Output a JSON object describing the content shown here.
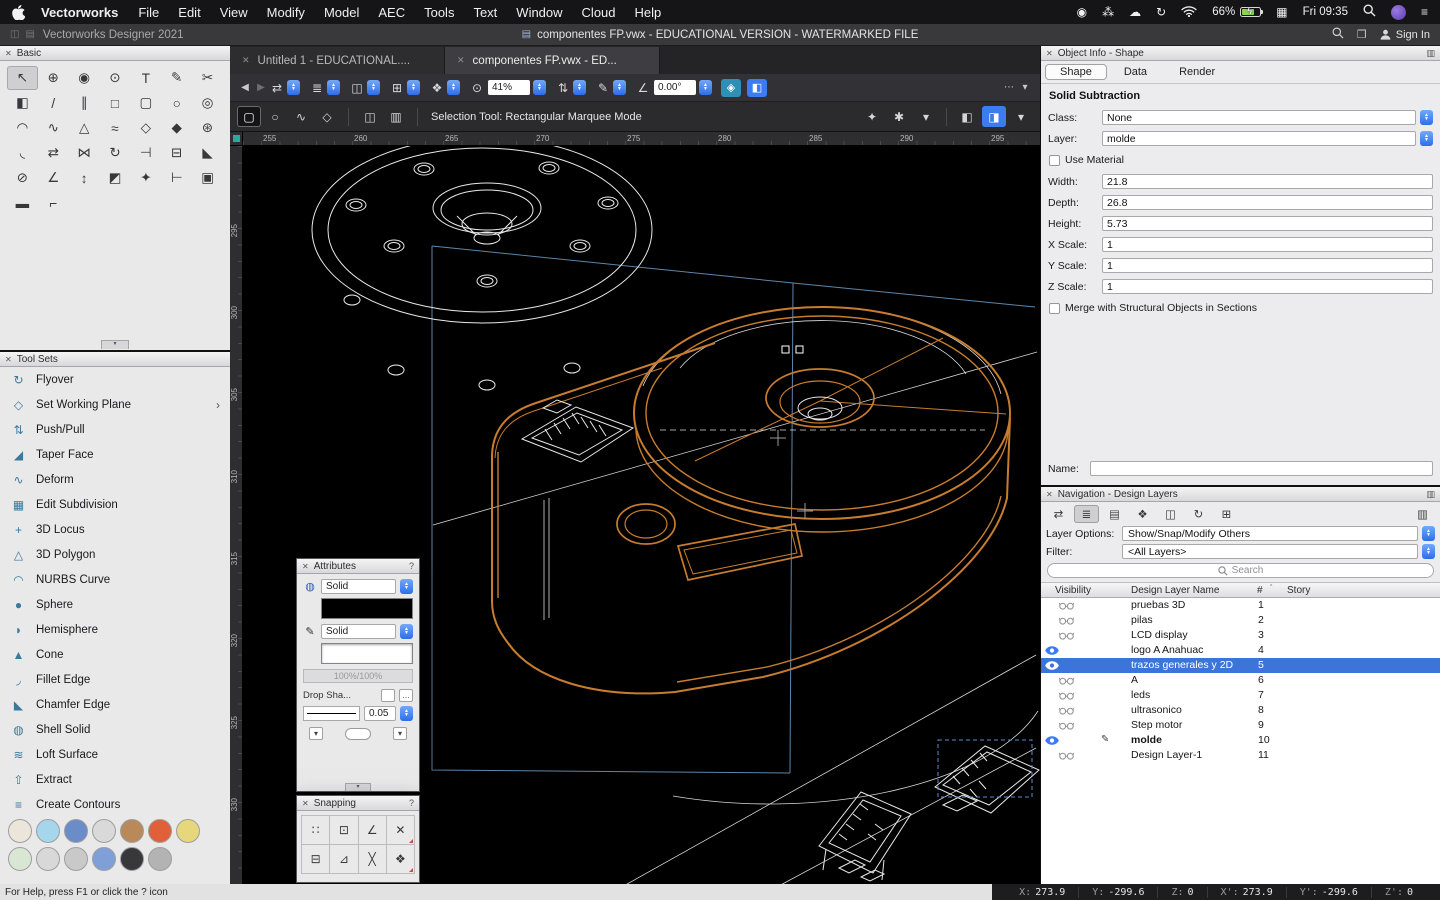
{
  "colors": {
    "accent_blue": "#3b7df0",
    "selection_blue": "#3d74d9",
    "canvas_bg": "#000000",
    "wireframe_white": "#e9e9ea",
    "highlight_orange": "#c87d2e",
    "construction_blue": "#5d86ac"
  },
  "icons": {
    "close": "✕",
    "document": "▤",
    "window_a": "◫",
    "window_b": "▤",
    "book": "❐",
    "help": "?",
    "palette_menu": "▥",
    "collapse": "▾",
    "small_chevron": "▾",
    "dots": "…",
    "chevron_right": "›",
    "sort": "ˆ",
    "display": "▦",
    "menu": "≡"
  },
  "menubar": {
    "app_name": "Vectorworks",
    "menus": [
      "File",
      "Edit",
      "View",
      "Modify",
      "Model",
      "AEC",
      "Tools",
      "Text",
      "Window",
      "Cloud",
      "Help"
    ],
    "status_icons": [
      {
        "name": "camera-icon",
        "glyph": "◉"
      },
      {
        "name": "paw-icon",
        "glyph": "⁂"
      },
      {
        "name": "cloud-icon",
        "glyph": "☁"
      },
      {
        "name": "sync-icon",
        "glyph": "↻"
      }
    ],
    "battery_pct": "66%",
    "clock": "Fri 09:35"
  },
  "titlebar": {
    "app_label": "Vectorworks Designer 2021",
    "doc_title": "componentes FP.vwx - EDUCATIONAL VERSION - WATERMARKED FILE",
    "sign_in_label": "Sign In"
  },
  "tabs": [
    {
      "label": "Untitled 1 - EDUCATIONAL...."
    },
    {
      "label": "componentes FP.vwx - ED..."
    }
  ],
  "toolbar": {
    "back_glyph": "◀",
    "forward_glyph": "▶",
    "groups": [
      {
        "name": "view-sync-control",
        "glyph": "⇄"
      },
      {
        "name": "layer-view-control",
        "glyph": "≣"
      },
      {
        "name": "plane-mode-control",
        "glyph": "◫"
      },
      {
        "name": "grid-control",
        "glyph": "⊞"
      },
      {
        "name": "class-options-control",
        "glyph": "❖"
      }
    ],
    "zoom_icon_glyph": "⊙",
    "zoom_value": "41%",
    "groups2": [
      {
        "name": "fit-view-control",
        "glyph": "⇅"
      },
      {
        "name": "annotation-control",
        "glyph": "✎"
      }
    ],
    "angle_icon_glyph": "∠",
    "angle_value": "0.00°",
    "groups3": [
      {
        "name": "render-mode-button",
        "glyph": "◈",
        "color": "#2f8fb5"
      },
      {
        "name": "view-preset-button",
        "glyph": "◧",
        "color": "#3b7df0"
      }
    ],
    "overflow_glyph": "⋯",
    "chevron_glyph": "▾",
    "mode_buttons": [
      {
        "name": "rectangular-marquee-mode",
        "glyph": "▢",
        "active": true
      },
      {
        "name": "oval-marquee-mode",
        "glyph": "○"
      },
      {
        "name": "lasso-marquee-mode",
        "glyph": "∿"
      },
      {
        "name": "polygon-marquee-mode",
        "glyph": "◇"
      }
    ],
    "mode_buttons2": [
      {
        "name": "interactive-scaling-mode",
        "glyph": "◫"
      },
      {
        "name": "symbol-insertion-mode",
        "glyph": "▥"
      }
    ],
    "mode_label": "Selection Tool: Rectangular Marquee Mode",
    "right_icons": [
      {
        "name": "magic-wand-button",
        "glyph": "✦"
      },
      {
        "name": "tool-preferences-gear",
        "glyph": "✱"
      },
      {
        "name": "gear-chevron",
        "glyph": "▾"
      },
      {
        "name": "separator"
      },
      {
        "name": "push-pull-cube-button",
        "glyph": "◧"
      },
      {
        "name": "auto-plane-cube-button",
        "glyph": "◨",
        "active": true
      },
      {
        "name": "cube-chevron",
        "glyph": "▾"
      }
    ]
  },
  "basic_palette": {
    "title": "Basic",
    "tools": [
      {
        "name": "tool-selection",
        "glyph": "↖"
      },
      {
        "name": "tool-pan",
        "glyph": "⊕"
      },
      {
        "name": "tool-flyover",
        "glyph": "◉"
      },
      {
        "name": "tool-zoom",
        "glyph": "⊙"
      },
      {
        "name": "tool-text",
        "glyph": "T"
      },
      {
        "name": "tool-callout",
        "glyph": "✎"
      },
      {
        "name": "tool-split",
        "glyph": "✂"
      },
      {
        "name": "tool-visibility",
        "glyph": "◧"
      },
      {
        "name": "tool-line",
        "glyph": "/"
      },
      {
        "name": "tool-double-line",
        "glyph": "∥"
      },
      {
        "name": "tool-rectangle",
        "glyph": "□"
      },
      {
        "name": "tool-rounded-rectangle",
        "glyph": "▢"
      },
      {
        "name": "tool-oval",
        "glyph": "○"
      },
      {
        "name": "tool-circle",
        "glyph": "◎"
      },
      {
        "name": "tool-arc",
        "glyph": "◠"
      },
      {
        "name": "tool-freehand",
        "glyph": "∿"
      },
      {
        "name": "tool-triangle",
        "glyph": "△"
      },
      {
        "name": "tool-polyline",
        "glyph": "≈"
      },
      {
        "name": "tool-polygon",
        "glyph": "◇"
      },
      {
        "name": "tool-regular-polygon",
        "glyph": "◆"
      },
      {
        "name": "tool-spiral",
        "glyph": "⊛"
      },
      {
        "name": "tool-fillet",
        "glyph": "◟"
      },
      {
        "name": "tool-offset",
        "glyph": "⇄"
      },
      {
        "name": "tool-mirror",
        "glyph": "⋈"
      },
      {
        "name": "tool-rotate",
        "glyph": "↻"
      },
      {
        "name": "tool-trim",
        "glyph": "⊣"
      },
      {
        "name": "tool-clip",
        "glyph": "⊟"
      },
      {
        "name": "tool-chamfer",
        "glyph": "◣"
      },
      {
        "name": "tool-drill",
        "glyph": "⊘"
      },
      {
        "name": "tool-protractor",
        "glyph": "∠"
      },
      {
        "name": "tool-move-by-points",
        "glyph": "↕"
      },
      {
        "name": "tool-attribute-mapping",
        "glyph": "◩"
      },
      {
        "name": "tool-eyedropper",
        "glyph": "✦"
      },
      {
        "name": "tool-tape-measure",
        "glyph": "⊢"
      },
      {
        "name": "tool-stamp",
        "glyph": "▣"
      },
      {
        "name": "tool-reshape",
        "glyph": "▬"
      },
      {
        "name": "tool-locus",
        "glyph": "⌐"
      }
    ]
  },
  "tool_sets": {
    "title": "Tool Sets",
    "items": [
      {
        "label": "Flyover",
        "glyph": "↻"
      },
      {
        "label": "Set Working Plane",
        "glyph": "◇",
        "chevron": true
      },
      {
        "label": "Push/Pull",
        "glyph": "⇅"
      },
      {
        "label": "Taper Face",
        "glyph": "◢"
      },
      {
        "label": "Deform",
        "glyph": "∿"
      },
      {
        "label": "Edit Subdivision",
        "glyph": "▦"
      },
      {
        "label": "3D Locus",
        "glyph": "+"
      },
      {
        "label": "3D Polygon",
        "glyph": "△"
      },
      {
        "label": "NURBS Curve",
        "glyph": "◠"
      },
      {
        "label": "Sphere",
        "glyph": "●"
      },
      {
        "label": "Hemisphere",
        "glyph": "◗"
      },
      {
        "label": "Cone",
        "glyph": "▲"
      },
      {
        "label": "Fillet Edge",
        "glyph": "◞"
      },
      {
        "label": "Chamfer Edge",
        "glyph": "◣"
      },
      {
        "label": "Shell Solid",
        "glyph": "◍"
      },
      {
        "label": "Loft Surface",
        "glyph": "≋"
      },
      {
        "label": "Extract",
        "glyph": "⇧"
      },
      {
        "label": "Create Contours",
        "glyph": "≡"
      }
    ],
    "footer_rows": [
      [
        {
          "name": "toolset-icon-teardrop",
          "color": "#ece5da"
        },
        {
          "name": "toolset-icon-droplet",
          "color": "#a6d6ec"
        },
        {
          "name": "toolset-icon-sphere",
          "color": "#6a8cc8"
        },
        {
          "name": "toolset-icon-ring",
          "color": "#d9d9d9"
        },
        {
          "name": "toolset-icon-pot",
          "color": "#b9895a"
        },
        {
          "name": "toolset-icon-flame",
          "color": "#e0603a"
        },
        {
          "name": "toolset-icon-clay",
          "color": "#e6d67c"
        }
      ],
      [
        {
          "name": "toolset-icon-plant",
          "color": "#d9e6d4"
        },
        {
          "name": "toolset-icon-pen",
          "color": "#d8d8d8"
        },
        {
          "name": "toolset-icon-cup",
          "color": "#c9c9c9"
        },
        {
          "name": "toolset-icon-blue",
          "color": "#7f9fd8"
        },
        {
          "name": "toolset-icon-dark-sphere",
          "color": "#38383a"
        },
        {
          "name": "toolset-icon-gear",
          "color": "#b3b3b3"
        }
      ]
    ]
  },
  "attributes": {
    "title": "Attributes",
    "fill_bucket_glyph": "◍",
    "pen_glyph": "✎",
    "fill_style": "Solid",
    "pen_style": "Solid",
    "opacity_label": "100%/100%",
    "drop_shadow_label": "Drop Sha...",
    "line_weight": "0.05"
  },
  "snapping": {
    "title": "Snapping",
    "buttons": [
      {
        "name": "snap-to-grid",
        "glyph": "∷"
      },
      {
        "name": "snap-to-object",
        "glyph": "⊡"
      },
      {
        "name": "snap-to-angle",
        "glyph": "∠"
      },
      {
        "name": "smart-points",
        "glyph": "✕"
      },
      {
        "name": "snap-to-distance",
        "glyph": "⊟"
      },
      {
        "name": "smart-edge",
        "glyph": "⊿"
      },
      {
        "name": "snap-to-intersection",
        "glyph": "╳"
      },
      {
        "name": "snap-loci",
        "glyph": "❖"
      }
    ]
  },
  "object_info": {
    "title": "Object Info - Shape",
    "tabs": [
      "Shape",
      "Data",
      "Render"
    ],
    "object_type": "Solid Subtraction",
    "class_label": "Class:",
    "class_value": "None",
    "layer_label": "Layer:",
    "layer_value": "molde",
    "use_material_label": "Use Material",
    "width_label": "Width:",
    "width_value": "21.8",
    "depth_label": "Depth:",
    "depth_value": "26.8",
    "height_label": "Height:",
    "height_value": "5.73",
    "xscale_label": "X Scale:",
    "xscale_value": "1",
    "yscale_label": "Y Scale:",
    "yscale_value": "1",
    "zscale_label": "Z Scale:",
    "zscale_value": "1",
    "merge_label": "Merge with Structural Objects in Sections",
    "name_label": "Name:",
    "name_value": ""
  },
  "navigation": {
    "title": "Navigation - Design Layers",
    "view_icons": [
      {
        "name": "edit-reference-icon",
        "glyph": "⇄"
      },
      {
        "name": "design-layers-icon",
        "glyph": "≣",
        "active": true
      },
      {
        "name": "sheet-layers-icon",
        "glyph": "▤"
      },
      {
        "name": "classes-icon",
        "glyph": "❖"
      },
      {
        "name": "viewports-icon",
        "glyph": "◫"
      },
      {
        "name": "saved-views-icon",
        "glyph": "↻"
      },
      {
        "name": "references-icon",
        "glyph": "⊞"
      },
      {
        "name": "palette-options-icon",
        "glyph": "▥",
        "right": true
      }
    ],
    "layer_options_label": "Layer Options:",
    "layer_options_value": "Show/Snap/Modify Others",
    "filter_label": "Filter:",
    "filter_value": "<All Layers>",
    "search_placeholder": "Search",
    "columns": [
      "Visibility",
      "Design Layer Name",
      "#",
      "Story"
    ],
    "layers": [
      {
        "name": "pruebas 3D",
        "num": "1",
        "visible": false
      },
      {
        "name": "pilas",
        "num": "2",
        "visible": false
      },
      {
        "name": "LCD display",
        "num": "3",
        "visible": false
      },
      {
        "name": "logo A Anahuac",
        "num": "4",
        "visible": true
      },
      {
        "name": "trazos generales y 2D",
        "num": "5",
        "visible": true,
        "selected": true
      },
      {
        "name": "A",
        "num": "6",
        "visible": false
      },
      {
        "name": "leds",
        "num": "7",
        "visible": false
      },
      {
        "name": "ultrasonico",
        "num": "8",
        "visible": false
      },
      {
        "name": "Step motor",
        "num": "9",
        "visible": false
      },
      {
        "name": "molde",
        "num": "10",
        "visible": true,
        "active": true
      },
      {
        "name": "Design Layer-1",
        "num": "11",
        "visible": false
      }
    ]
  },
  "rulers": {
    "horizontal": [
      "255",
      "260",
      "265",
      "270",
      "275",
      "280",
      "285",
      "290",
      "295"
    ],
    "vertical": [
      "295",
      "300",
      "305",
      "310",
      "315",
      "320",
      "325",
      "330"
    ]
  },
  "statusbar": {
    "help_text": "For Help, press F1 or click the ? icon",
    "coords": [
      {
        "label": "X:",
        "value": "273.9"
      },
      {
        "label": "Y:",
        "value": "-299.6"
      },
      {
        "label": "Z:",
        "value": "0"
      },
      {
        "label": "X':",
        "value": "273.9"
      },
      {
        "label": "Y':",
        "value": "-299.6"
      },
      {
        "label": "Z':",
        "value": "0"
      }
    ]
  }
}
